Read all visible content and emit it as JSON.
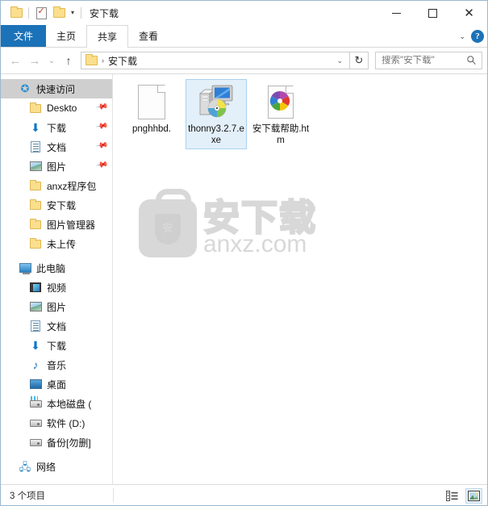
{
  "window": {
    "title": "安下载",
    "controls": {
      "minimize": "minimize-button",
      "maximize": "maximize-button",
      "close": "close-button"
    }
  },
  "quick_access_toolbar": {
    "items": [
      {
        "name": "folder-icon",
        "label": ""
      },
      {
        "name": "properties-icon",
        "label": ""
      },
      {
        "name": "new-folder-icon",
        "label": ""
      },
      {
        "name": "customize-caret",
        "label": "▾"
      }
    ]
  },
  "ribbon": {
    "tabs": [
      {
        "label": "文件",
        "state": "file"
      },
      {
        "label": "主页",
        "state": "normal"
      },
      {
        "label": "共享",
        "state": "active"
      },
      {
        "label": "查看",
        "state": "normal"
      }
    ],
    "collapse_caret": "⌄",
    "help_label": "?"
  },
  "addressbar": {
    "back": "←",
    "forward": "→",
    "recent": "⌄",
    "up": "↑",
    "breadcrumb_separator": "›",
    "path": "安下载",
    "dropdown_caret": "⌄",
    "refresh": "↻"
  },
  "search": {
    "placeholder": "搜索\"安下载\"",
    "value": ""
  },
  "navpane": {
    "items": [
      {
        "label": "快速访问",
        "icon": "star-pin-icon",
        "level": 0,
        "selected": true,
        "pinned": false
      },
      {
        "label": "Deskto",
        "icon": "folder-icon",
        "level": 1,
        "selected": false,
        "pinned": true
      },
      {
        "label": "下载",
        "icon": "download-arrow-icon",
        "level": 1,
        "selected": false,
        "pinned": true
      },
      {
        "label": "文档",
        "icon": "document-icon",
        "level": 1,
        "selected": false,
        "pinned": true
      },
      {
        "label": "图片",
        "icon": "pictures-icon",
        "level": 1,
        "selected": false,
        "pinned": true
      },
      {
        "label": "anxz程序包",
        "icon": "folder-icon",
        "level": 1,
        "selected": false,
        "pinned": false
      },
      {
        "label": "安下载",
        "icon": "folder-icon",
        "level": 1,
        "selected": false,
        "pinned": false
      },
      {
        "label": "图片管理器",
        "icon": "folder-icon",
        "level": 1,
        "selected": false,
        "pinned": false
      },
      {
        "label": "未上传",
        "icon": "folder-icon",
        "level": 1,
        "selected": false,
        "pinned": false
      },
      {
        "label": "此电脑",
        "icon": "this-pc-icon",
        "level": 0,
        "selected": false,
        "pinned": false
      },
      {
        "label": "视频",
        "icon": "videos-icon",
        "level": 1,
        "selected": false,
        "pinned": false
      },
      {
        "label": "图片",
        "icon": "pictures-icon",
        "level": 1,
        "selected": false,
        "pinned": false
      },
      {
        "label": "文档",
        "icon": "document-icon",
        "level": 1,
        "selected": false,
        "pinned": false
      },
      {
        "label": "下载",
        "icon": "download-arrow-icon",
        "level": 1,
        "selected": false,
        "pinned": false
      },
      {
        "label": "音乐",
        "icon": "music-note-icon",
        "level": 1,
        "selected": false,
        "pinned": false
      },
      {
        "label": "桌面",
        "icon": "desktop-icon",
        "level": 1,
        "selected": false,
        "pinned": false
      },
      {
        "label": "本地磁盘 (",
        "icon": "system-drive-icon",
        "level": 1,
        "selected": false,
        "pinned": false
      },
      {
        "label": "软件 (D:)",
        "icon": "drive-icon",
        "level": 1,
        "selected": false,
        "pinned": false
      },
      {
        "label": "备份[勿删]",
        "icon": "drive-icon",
        "level": 1,
        "selected": false,
        "pinned": false
      },
      {
        "label": "网络",
        "icon": "network-icon",
        "level": 0,
        "selected": false,
        "pinned": false
      }
    ]
  },
  "files": [
    {
      "name": "pnghhbd.",
      "icon": "blank-page-icon",
      "selected": false
    },
    {
      "name": "thonny3.2.7.exe",
      "icon": "installer-exe-icon",
      "selected": true
    },
    {
      "name": "安下载帮助.htm",
      "icon": "html-chrome-icon",
      "selected": false
    }
  ],
  "watermark": {
    "badge_char": "安",
    "brand_cn": "安下载",
    "domain": "anxz.com"
  },
  "statusbar": {
    "item_count": "3 个项目",
    "views": [
      {
        "name": "details-view-button",
        "active": false
      },
      {
        "name": "large-icons-view-button",
        "active": true
      }
    ]
  },
  "colors": {
    "accent": "#1c72b8",
    "selection": "#e3f0fa",
    "selection_border": "#a8d2ee",
    "nav_selected": "#cfcfcf",
    "window_border": "#9bb8d0",
    "folder_yellow": "#fbdf8e",
    "watermark_gray": "#d8d8d8"
  }
}
